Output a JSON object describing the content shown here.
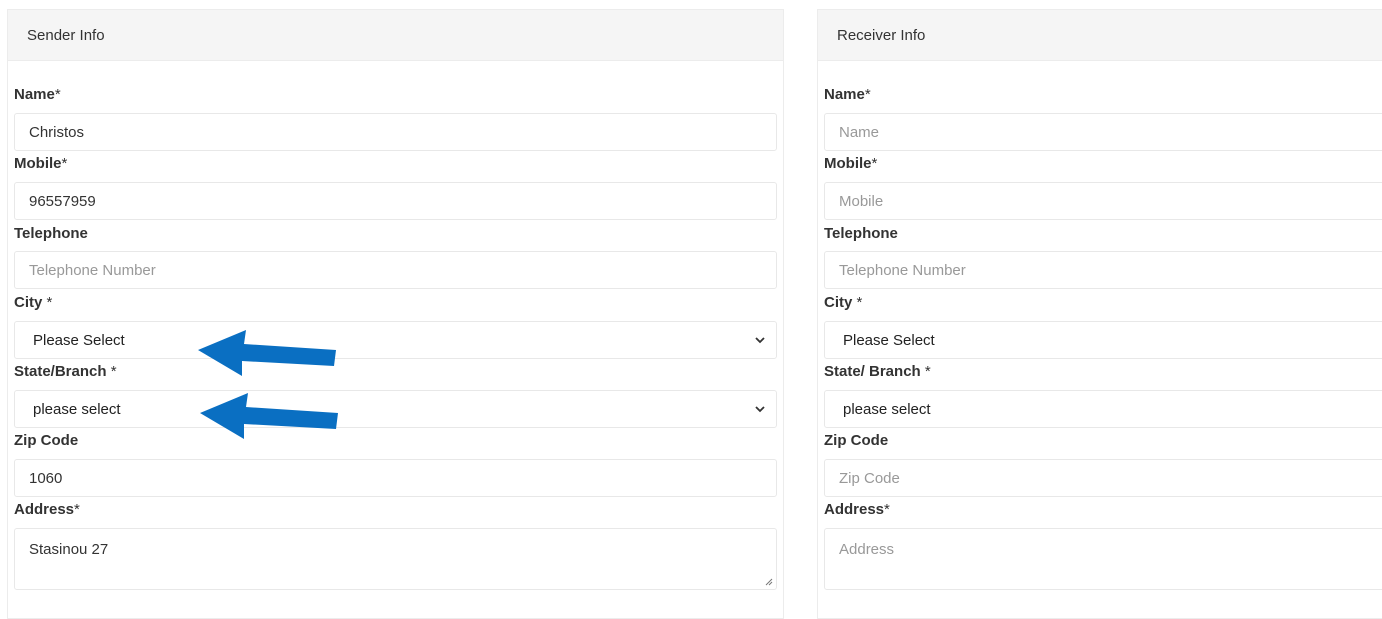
{
  "sender": {
    "title": "Sender Info",
    "name_label": "Name",
    "name_star": "*",
    "name_value": "Christos",
    "mobile_label": "Mobile",
    "mobile_star": "*",
    "mobile_value": "96557959",
    "telephone_label": "Telephone",
    "telephone_placeholder": "Telephone Number",
    "city_label": "City",
    "city_star": " *",
    "city_value": "Please Select",
    "state_label": "State/Branch",
    "state_star": " *",
    "state_value": "please select",
    "zip_label": "Zip Code",
    "zip_value": "1060",
    "address_label": "Address",
    "address_star": "*",
    "address_value": "Stasinou 27"
  },
  "receiver": {
    "title": "Receiver Info",
    "name_label": "Name",
    "name_star": "*",
    "name_placeholder": "Name",
    "mobile_label": "Mobile",
    "mobile_star": "*",
    "mobile_placeholder": "Mobile",
    "telephone_label": "Telephone",
    "telephone_placeholder": "Telephone Number",
    "city_label": "City",
    "city_star": " *",
    "city_value": "Please Select",
    "state_label": "State/ Branch",
    "state_star": " *",
    "state_value": "please select",
    "zip_label": "Zip Code",
    "zip_placeholder": "Zip Code",
    "address_label": "Address",
    "address_star": "*",
    "address_placeholder": "Address"
  },
  "colors": {
    "arrow": "#0a6fc2",
    "header_bg": "#f5f5f5",
    "placeholder": "#999999"
  },
  "icons": {
    "select_chevron": "chevron-down-icon",
    "annotation_arrow": "arrow-left-icon",
    "textarea_grip": "resize-grip-icon"
  }
}
